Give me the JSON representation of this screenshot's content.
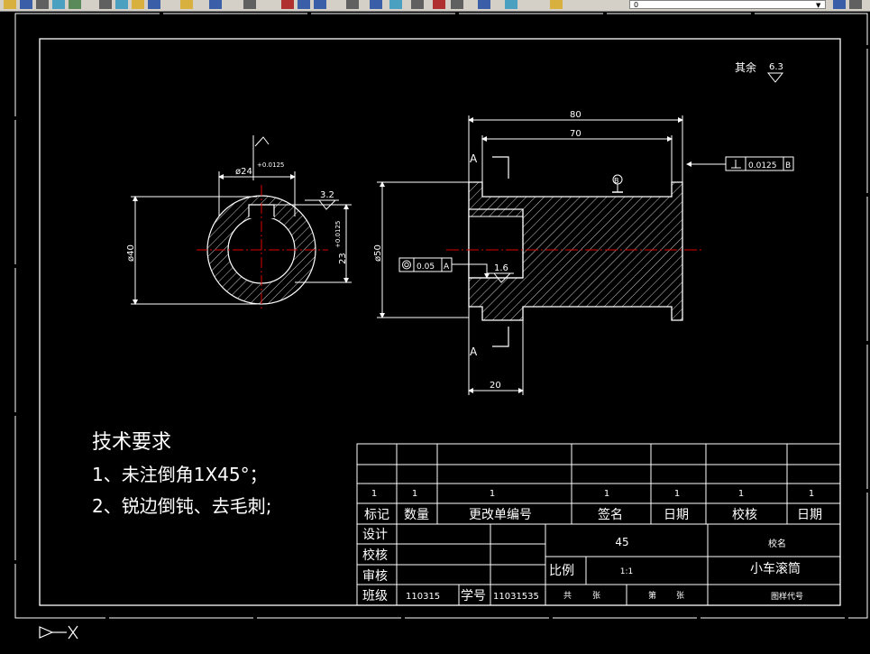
{
  "toolbar": {
    "icons": [
      "open-icon",
      "save-icon",
      "print-icon",
      "preview-icon",
      "publish-icon",
      "cut-icon",
      "copy-icon",
      "paste-icon",
      "match-icon",
      "undo-icon",
      "redo-icon",
      "pan-icon",
      "zoom-realtime-icon",
      "zoom-window-icon",
      "zoom-previous-icon",
      "properties-icon",
      "design-center-icon",
      "tool-palette-icon",
      "sheet-set-icon",
      "markup-icon",
      "calculator-icon",
      "help-icon",
      "layer-manager-icon",
      "layer-state-icon"
    ],
    "layer_value": "0"
  },
  "drawing": {
    "roughness_note_label": "其余",
    "roughness_note_value": "6.3",
    "dim_80": "80",
    "dim_70": "70",
    "dim_20": "20",
    "dim_phi50": "ø50",
    "dim_phi40": "ø40",
    "dim_phi24": "ø24",
    "dim_phi24_tol": "+0.0125",
    "dim_23": "23",
    "dim_23_tol": "+0.0125",
    "roughness_32": "3.2",
    "roughness_16": "1.6",
    "section_label_top": "A",
    "section_label_bottom": "A",
    "perp_tol_value": "0.0125",
    "perp_tol_datum": "B",
    "conc_tol_value": "0.05",
    "conc_tol_datum": "A",
    "datum_b": "B"
  },
  "notes": {
    "title": "技术要求",
    "line1": "1、未注倒角1X45°；",
    "line2": "2、锐边倒钝、去毛刺;"
  },
  "titleblock": {
    "rev_row": [
      "1",
      "1",
      "1",
      "1",
      "1",
      "1",
      "1"
    ],
    "headers": [
      "标记",
      "数量",
      "更改单编号",
      "签名",
      "日期",
      "校核",
      "日期"
    ],
    "labels": {
      "design": "设计",
      "check": "校核",
      "review": "审核",
      "class": "班级",
      "student_no": "学号",
      "scale": "比例",
      "sheets_total": "共",
      "sheets_unit": "张",
      "sheet_no": "第",
      "sheet_unit2": "张"
    },
    "class_value": "110315",
    "student_no_value": "11031535",
    "material": "45",
    "school": "校名",
    "scale_value": "1:1",
    "part_name": "小车滚筒",
    "drawing_code": "图样代号"
  }
}
